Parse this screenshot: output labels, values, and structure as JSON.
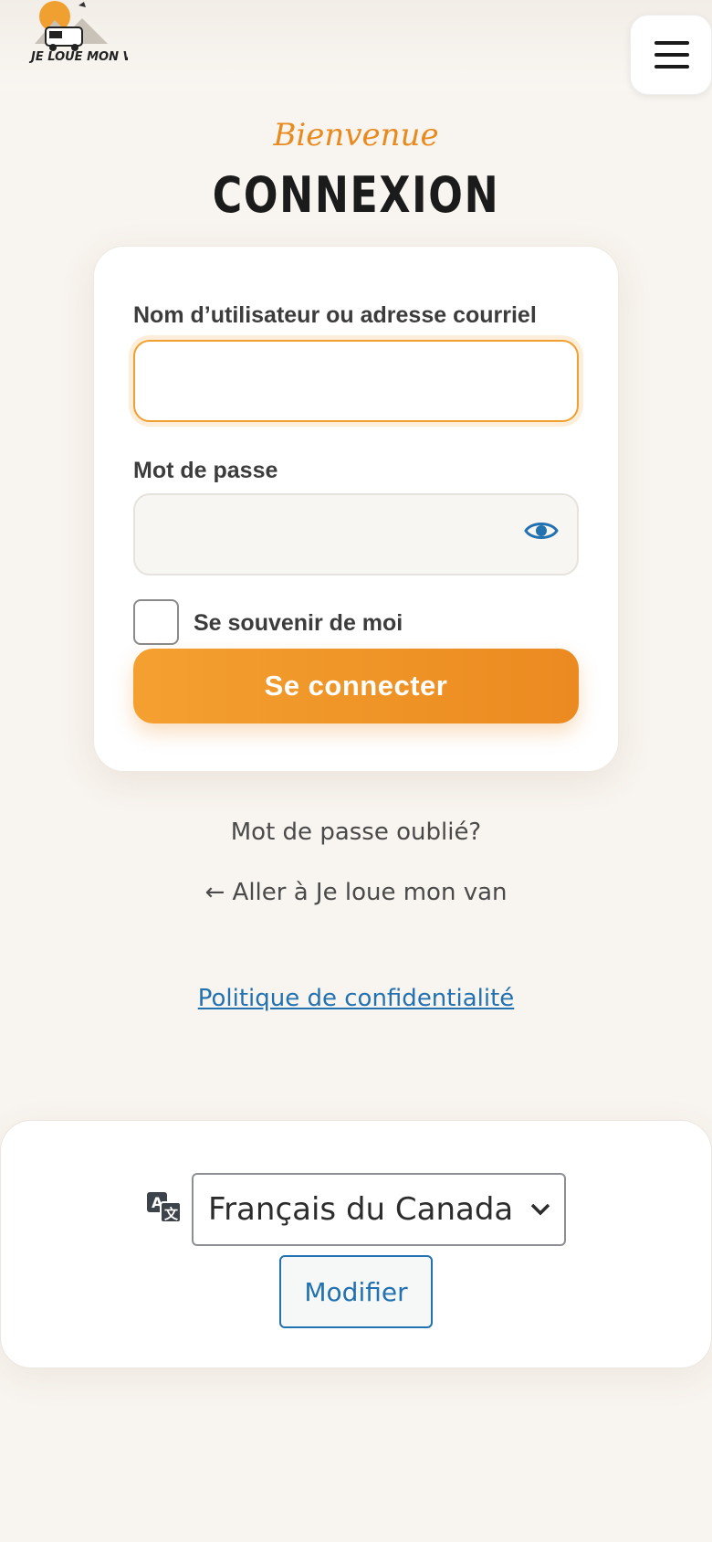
{
  "header": {
    "logo_text": "JE LOUE MON VAN",
    "menu_icon": "hamburger-menu-icon"
  },
  "heading": {
    "eyebrow": "Bienvenue",
    "title": "CONNEXION"
  },
  "form": {
    "username_label": "Nom d’utilisateur ou adresse courriel",
    "username_value": "",
    "password_label": "Mot de passe",
    "password_value": "",
    "password_toggle_icon": "eye-icon",
    "remember_label": "Se souvenir de moi",
    "remember_checked": false,
    "submit_label": "Se connecter"
  },
  "links": {
    "lost_password": "Mot de passe oublié?",
    "back_to_site": "← Aller à Je loue mon van",
    "privacy_policy": "Politique de confidentialité"
  },
  "language": {
    "icon": "translate-icon",
    "selected": "Français du Canada",
    "change_button": "Modifier"
  },
  "colors": {
    "accent": "#f0a030",
    "accent_dark": "#eb8a20",
    "link": "#2271b1",
    "background": "#f8f4ef"
  }
}
